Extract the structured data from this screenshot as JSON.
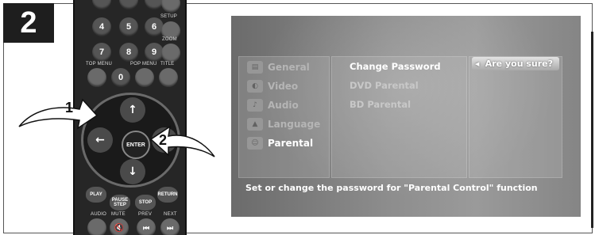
{
  "step": "2",
  "remote": {
    "number_buttons": [
      "4",
      "5",
      "6",
      "7",
      "8",
      "9",
      "0"
    ],
    "labels": {
      "setup": "SETUP",
      "zoom": "ZOOM",
      "top_menu": "TOP MENU",
      "pop_menu": "POP MENU",
      "title": "TITLE",
      "audio": "AUDIO",
      "mute": "MUTE",
      "prev": "PREV",
      "next": "NEXT"
    },
    "enter": "ENTER",
    "up": "↑",
    "down": "↓",
    "left": "←",
    "play": "PLAY",
    "pause": "PAUSE STEP",
    "stop": "STOP",
    "return": "RETURN"
  },
  "callouts": [
    "1",
    "2"
  ],
  "screen": {
    "menu": [
      {
        "label": "General",
        "icon": "general-icon",
        "active": false
      },
      {
        "label": "Video",
        "icon": "video-icon",
        "active": false
      },
      {
        "label": "Audio",
        "icon": "audio-icon",
        "active": false
      },
      {
        "label": "Language",
        "icon": "language-icon",
        "active": false
      },
      {
        "label": "Parental",
        "icon": "parental-icon",
        "active": true
      }
    ],
    "submenu": [
      {
        "label": "Change Password",
        "active": true
      },
      {
        "label": "DVD Parental",
        "active": false
      },
      {
        "label": "BD Parental",
        "active": false
      }
    ],
    "confirm": "Are you sure?",
    "status": "Set or change the password for \"Parental Control\" function"
  }
}
